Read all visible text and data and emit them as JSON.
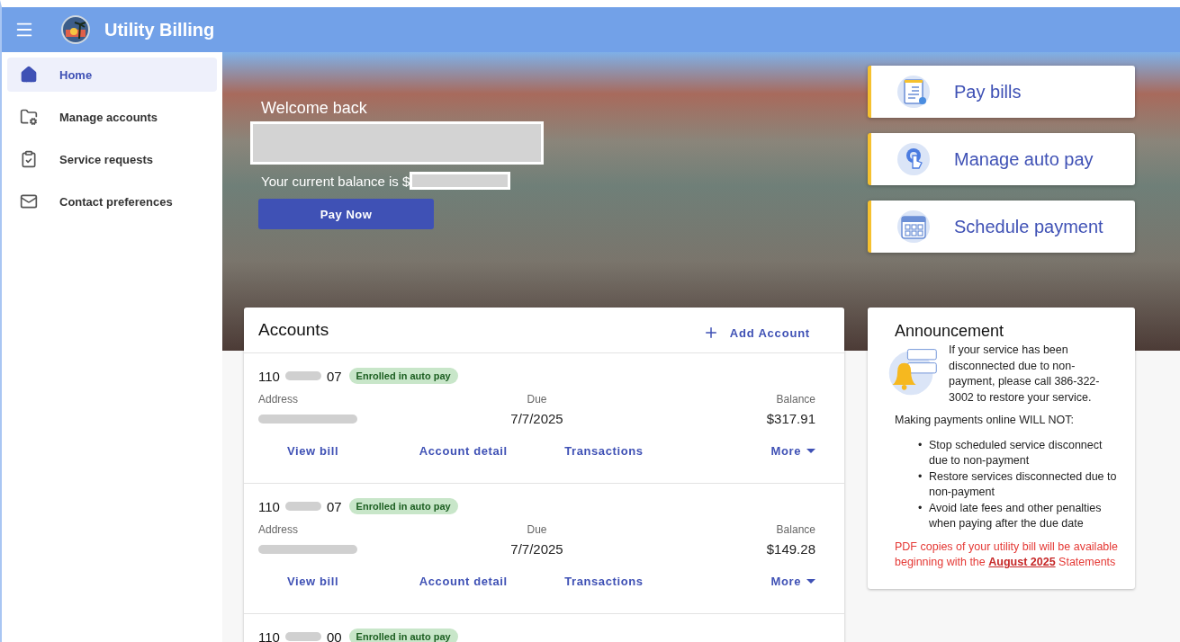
{
  "app": {
    "title": "Utility Billing"
  },
  "sidebar": {
    "items": [
      {
        "label": "Home",
        "selected": true
      },
      {
        "label": "Manage accounts",
        "selected": false
      },
      {
        "label": "Service requests",
        "selected": false
      },
      {
        "label": "Contact preferences",
        "selected": false
      }
    ]
  },
  "hero": {
    "greeting": "Welcome back",
    "balance_label": "Your current balance is $",
    "pay_button": "Pay Now"
  },
  "quick_actions": [
    {
      "label": "Pay bills"
    },
    {
      "label": "Manage auto pay"
    },
    {
      "label": "Schedule payment"
    }
  ],
  "accounts": {
    "title": "Accounts",
    "add_button": "Add Account",
    "items": [
      {
        "number_start": "110",
        "number_end": "07",
        "badge": "Enrolled in auto pay",
        "address_label": "Address",
        "due_label": "Due",
        "due": "7/7/2025",
        "balance_label": "Balance",
        "balance": "$317.91",
        "actions": [
          "View bill",
          "Account detail",
          "Transactions",
          "More"
        ]
      },
      {
        "number_start": "110",
        "number_end": "07",
        "badge": "Enrolled in auto pay",
        "address_label": "Address",
        "due_label": "Due",
        "due": "7/7/2025",
        "balance_label": "Balance",
        "balance": "$149.28",
        "actions": [
          "View bill",
          "Account detail",
          "Transactions",
          "More"
        ]
      },
      {
        "number_start": "110",
        "number_end": "00",
        "badge": "Enrolled in auto pay"
      }
    ]
  },
  "announcement": {
    "title": "Announcement",
    "intro": "If your service has been disconnected due to non-payment, please call 386-322-3002 to restore your service.",
    "subheading": "Making payments online WILL NOT:",
    "bullet_marker": "•",
    "bullets": [
      "Stop scheduled service disconnect due to non-payment",
      "Restore services disconnected due to non-payment",
      "Avoid late fees and other penalties when paying after the due date"
    ],
    "notice_before": "PDF copies of your utility bill will be available beginning with the",
    "notice_link": "August 2025",
    "notice_after": "Statements"
  }
}
